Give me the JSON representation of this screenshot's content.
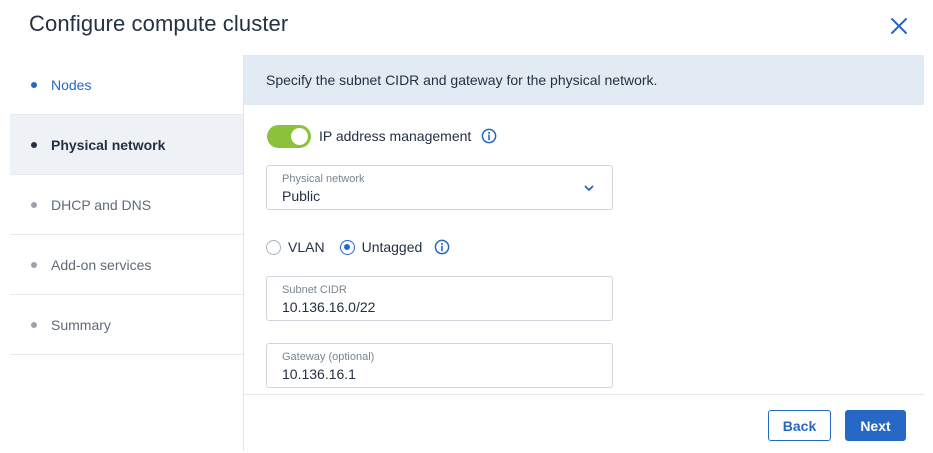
{
  "dialog": {
    "title": "Configure compute cluster",
    "close_icon": "close-icon"
  },
  "steps": [
    {
      "label": "Nodes",
      "state": "completed"
    },
    {
      "label": "Physical network",
      "state": "active"
    },
    {
      "label": "DHCP and DNS",
      "state": "pending"
    },
    {
      "label": "Add-on services",
      "state": "pending"
    },
    {
      "label": "Summary",
      "state": "pending"
    }
  ],
  "main": {
    "instruction": "Specify the subnet CIDR and gateway for the physical network.",
    "ip_management": {
      "label": "IP address management",
      "enabled": true,
      "info_icon": "info-icon"
    },
    "physical_network": {
      "label": "Physical network",
      "value": "Public",
      "icon": "chevron-down-icon"
    },
    "vlan_mode": {
      "options": [
        "VLAN",
        "Untagged"
      ],
      "selected": "Untagged",
      "info_icon": "info-icon"
    },
    "subnet_cidr": {
      "label": "Subnet CIDR",
      "value": "10.136.16.0/22"
    },
    "gateway": {
      "label": "Gateway (optional)",
      "value": "10.136.16.1"
    }
  },
  "footer": {
    "back_label": "Back",
    "next_label": "Next"
  },
  "colors": {
    "accent": "#2668c5",
    "toggle_on": "#8bc23c",
    "banner_bg": "#e2ebf4",
    "active_step_bg": "#eef1f5"
  }
}
